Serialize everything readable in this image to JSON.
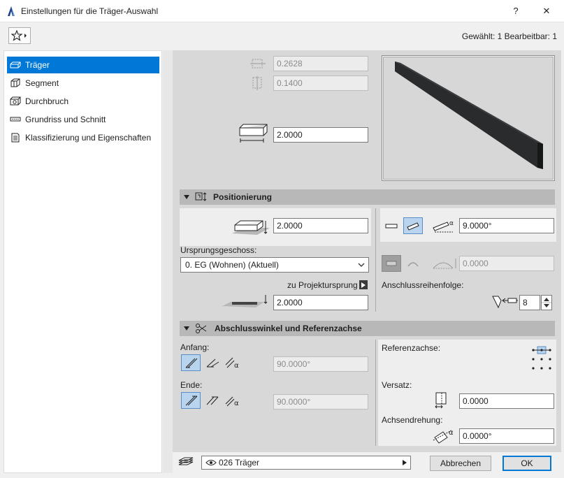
{
  "window": {
    "title": "Einstellungen für die Träger-Auswahl",
    "help_label": "?",
    "close_label": "✕"
  },
  "toolbar": {
    "selection_info": "Gewählt: 1 Bearbeitbar: 1"
  },
  "sidebar": {
    "items": [
      {
        "label": "Träger",
        "icon": "beam-icon"
      },
      {
        "label": "Segment",
        "icon": "segment-icon"
      },
      {
        "label": "Durchbruch",
        "icon": "hole-icon"
      },
      {
        "label": "Grundriss und Schnitt",
        "icon": "floorplan-section-icon"
      },
      {
        "label": "Klassifizierung und Eigenschaften",
        "icon": "classification-icon"
      }
    ]
  },
  "geometry": {
    "width_value": "0.2628",
    "height_value": "0.1400",
    "length_value": "2.0000"
  },
  "positioning": {
    "section_title": "Positionierung",
    "offset_value": "2.0000",
    "home_story_label": "Ursprungsgeschoss:",
    "home_story_value": "0. EG (Wohnen) (Aktuell)",
    "project_zero_label": "zu Projektursprung",
    "project_zero_value": "2.0000",
    "slant_angle_value": "9.0000°",
    "arc_value": "0.0000",
    "priority_label": "Anschlussreihenfolge:",
    "priority_value": "8"
  },
  "end_cuts": {
    "section_title": "Abschlusswinkel und Referenzachse",
    "start_label": "Anfang:",
    "start_angle_value": "90.0000°",
    "end_label": "Ende:",
    "end_angle_value": "90.0000°",
    "reference_axis_label": "Referenzachse:",
    "offset_label": "Versatz:",
    "offset_value": "0.0000",
    "rotation_label": "Achsendrehung:",
    "rotation_value": "0.0000°"
  },
  "footer": {
    "layer_value": "026 Träger",
    "cancel_label": "Abbrechen",
    "ok_label": "OK"
  }
}
